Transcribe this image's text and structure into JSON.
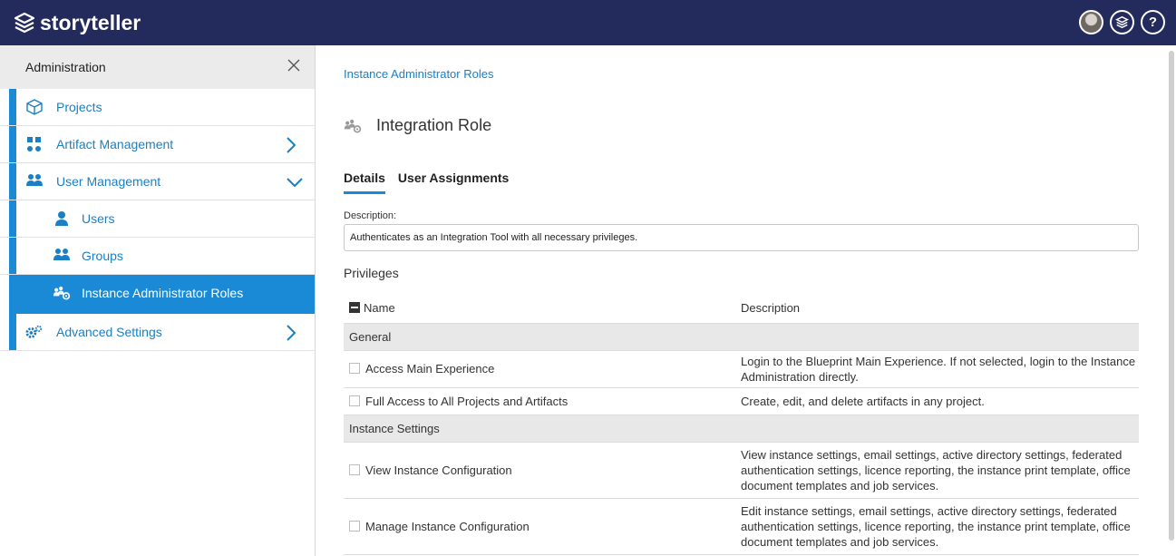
{
  "header": {
    "brand": "storyteller",
    "icons": [
      "user-avatar",
      "storyteller-stack-icon",
      "help-icon"
    ],
    "help_glyph": "?"
  },
  "colors": {
    "topbar": "#232a5c",
    "accent": "#1a8ad6",
    "link": "#1a7fc4"
  },
  "sidebar": {
    "title": "Administration",
    "items": [
      {
        "label": "Projects",
        "icon": "cube-icon"
      },
      {
        "label": "Artifact Management",
        "icon": "artifact-icon",
        "expandable": true,
        "expanded": false
      },
      {
        "label": "User Management",
        "icon": "users-icon",
        "expandable": true,
        "expanded": true
      },
      {
        "label": "Users",
        "icon": "user-icon",
        "sub": true
      },
      {
        "label": "Groups",
        "icon": "groups-icon",
        "sub": true
      },
      {
        "label": "Instance Administrator Roles",
        "icon": "roles-icon",
        "sub": true,
        "active": true
      },
      {
        "label": "Advanced Settings",
        "icon": "gears-icon",
        "expandable": true,
        "expanded": false
      }
    ]
  },
  "main": {
    "breadcrumb": "Instance Administrator Roles",
    "title": "Integration Role",
    "tabs": [
      {
        "label": "Details",
        "active": true
      },
      {
        "label": "User Assignments",
        "active": false
      }
    ],
    "description_label": "Description:",
    "description_value": "Authenticates as an Integration Tool with all necessary privileges.",
    "privileges_label": "Privileges",
    "table": {
      "headers": [
        "Name",
        "Description"
      ],
      "groups": [
        {
          "name": "General",
          "rows": [
            {
              "name": "Access Main Experience",
              "description": "Login to the Blueprint Main Experience. If not selected, login to the Instance Administration directly."
            },
            {
              "name": "Full Access to All Projects and Artifacts",
              "description": "Create, edit, and delete artifacts in any project."
            }
          ]
        },
        {
          "name": "Instance Settings",
          "rows": [
            {
              "name": "View Instance Configuration",
              "description": "View instance settings, email settings, active directory settings, federated authentication settings, licence reporting, the instance print template, office document templates and job services."
            },
            {
              "name": "Manage Instance Configuration",
              "description": "Edit instance settings, email settings, active directory settings, federated authentication settings, licence reporting, the instance print template, office document templates and job services."
            }
          ]
        }
      ]
    }
  }
}
